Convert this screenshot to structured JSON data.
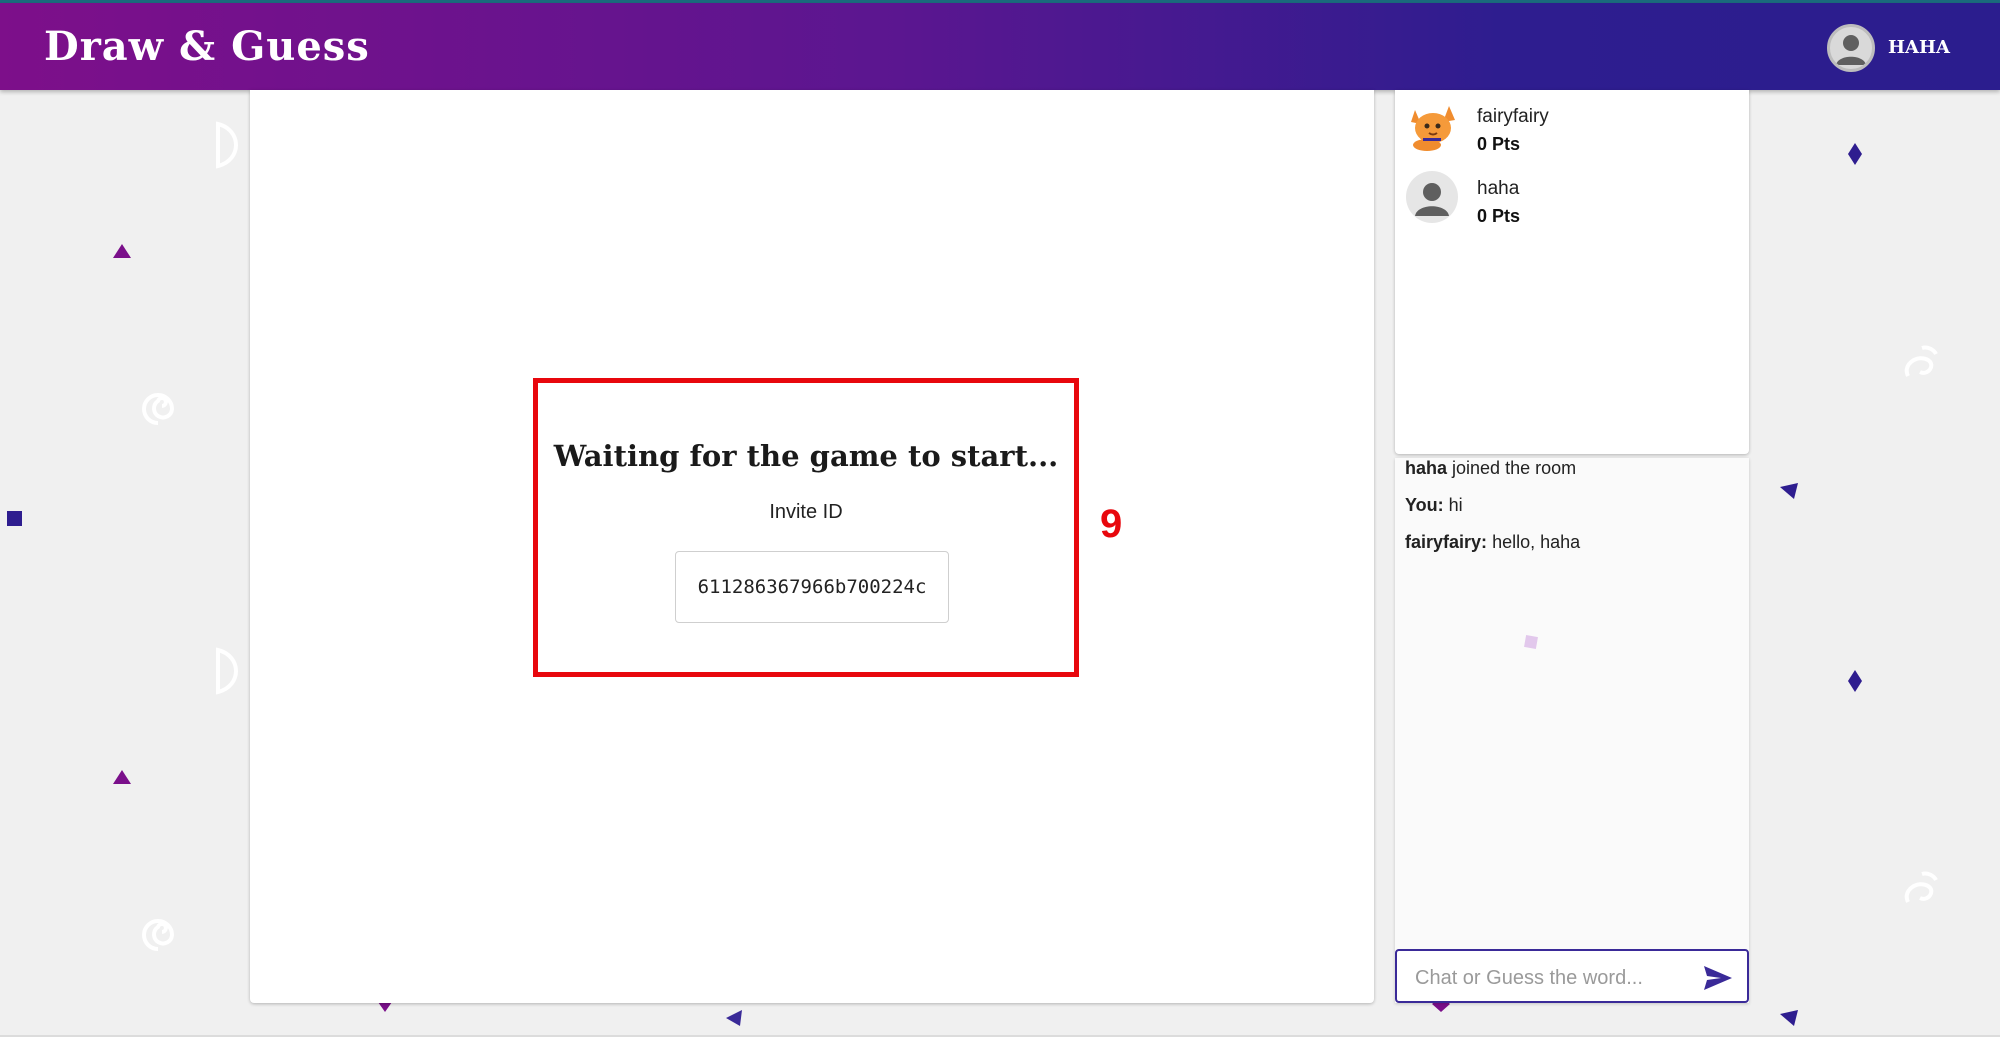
{
  "header": {
    "logo": "Draw & Guess",
    "username": "HAHA"
  },
  "canvas": {
    "waiting_title": "Waiting for the game to start...",
    "invite_label": "Invite ID",
    "invite_id": "611286367966b700224c"
  },
  "annotation": {
    "step": "9"
  },
  "players": [
    {
      "name": "fairyfairy",
      "score": "0 Pts",
      "avatar": "cat-avatar-icon"
    },
    {
      "name": "haha",
      "score": "0 Pts",
      "avatar": "default-user-avatar-icon"
    }
  ],
  "chat": {
    "messages": [
      {
        "sender": "haha",
        "sep": " ",
        "text": "joined the room"
      },
      {
        "sender": "You:",
        "sep": " ",
        "text": "hi"
      },
      {
        "sender": "fairyfairy:",
        "sep": " ",
        "text": "hello, haha"
      }
    ],
    "input_placeholder": "Chat or Guess the word..."
  },
  "colors": {
    "header_gradient_start": "#7d0f8a",
    "header_gradient_end": "#2b1d8e",
    "highlight": "#e8070d",
    "accent": "#3a2a98"
  }
}
